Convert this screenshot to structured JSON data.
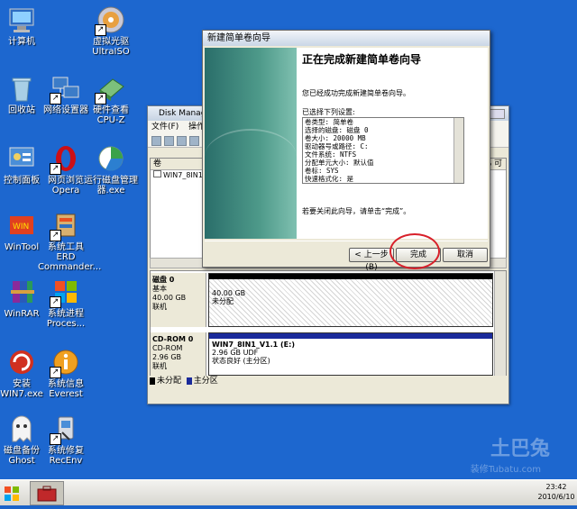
{
  "desktop_icons": [
    {
      "label": "计算机",
      "icon": "computer-icon"
    },
    {
      "label": "虚拟光驱\nUltraISO",
      "icon": "disc-icon"
    },
    {
      "label": "回收站",
      "icon": "recycle-bin-icon"
    },
    {
      "label": "网络设置器",
      "icon": "network-icon"
    },
    {
      "label": "硬件查看\nCPU-Z",
      "icon": "cpu-icon"
    },
    {
      "label": "控制面板",
      "icon": "control-panel-icon"
    },
    {
      "label": "网页浏览\nOpera",
      "icon": "opera-icon"
    },
    {
      "label": "运行磁盘管理\n器.exe",
      "icon": "disk-manager-icon"
    },
    {
      "label": "WinTool",
      "icon": "wintool-icon"
    },
    {
      "label": "系统工具 ERD\nCommander...",
      "icon": "erd-icon"
    },
    {
      "label": "WinRAR",
      "icon": "winrar-icon"
    },
    {
      "label": "系统进程\nProces...",
      "icon": "process-icon"
    },
    {
      "label": "安装WIN7.exe",
      "icon": "install-icon"
    },
    {
      "label": "系统信息\nEverest",
      "icon": "info-icon"
    },
    {
      "label": "磁盘备份\nGhost",
      "icon": "ghost-icon"
    },
    {
      "label": "系统修复\nRecEnv",
      "icon": "repair-icon"
    }
  ],
  "disk_manager": {
    "title": "Disk Manager",
    "menu": [
      "文件(F)",
      "操作(A"
    ],
    "list_header": "卷",
    "list_header_right": "% 可",
    "list_rows": [
      "WIN7_8IN1_V1.1"
    ],
    "disks": [
      {
        "name": "磁盘 0",
        "type": "基本",
        "size": "40.00 GB",
        "status": "联机",
        "volume_size": "40.00 GB",
        "volume_status": "未分配"
      },
      {
        "name": "CD-ROM 0",
        "type": "CD-ROM",
        "size": "2.96 GB",
        "status": "联机",
        "volume_name": "WIN7_8IN1_V1.1 (E:)",
        "volume_size": "2.96 GB UDF",
        "volume_status": "状态良好 (主分区)"
      }
    ],
    "legend": [
      "未分配",
      "主分区"
    ]
  },
  "wizard": {
    "title": "新建简单卷向导",
    "heading": "正在完成新建简单卷向导",
    "intro": "您已经成功完成新建简单卷向导。",
    "settings_label": "已选择下列设置:",
    "settings": [
      "卷类型: 简单卷",
      "选择的磁盘: 磁盘 0",
      "卷大小: 20000 MB",
      "驱动器号或路径: C:",
      "文件系统: NTFS",
      "分配单元大小: 默认值",
      "卷标: SYS",
      "快速格式化: 是"
    ],
    "close_hint": "若要关闭此向导，请单击“完成”。",
    "back_label": "< 上一步(B)",
    "finish_label": "完成",
    "cancel_label": "取消"
  },
  "taskbar": {
    "time": "23:42",
    "date": "2010/6/10"
  },
  "watermark": {
    "brand": "土巴兔",
    "site": "装修Tubatu.com"
  },
  "colors": {
    "desktop": "#1d67cf",
    "highlight_circle": "#d8202a",
    "primary_partition": "#1a2a9a"
  }
}
